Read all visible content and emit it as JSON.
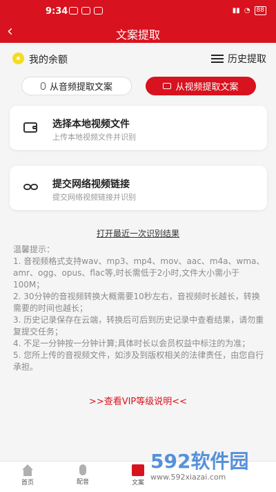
{
  "status_bar": {
    "time": "9:34",
    "battery": "88"
  },
  "header": {
    "title": "文案提取"
  },
  "balance": {
    "label": "我的余额"
  },
  "history": {
    "label": "历史提取"
  },
  "tabs": [
    {
      "label": "从音频提取文案",
      "active": false
    },
    {
      "label": "从视频提取文案",
      "active": true
    }
  ],
  "cards": [
    {
      "title": "选择本地视频文件",
      "subtitle": "上传本地视频文件并识别",
      "icon": "wallet-icon"
    },
    {
      "title": "提交网络视频链接",
      "subtitle": "提交网络视频链接并识别",
      "icon": "link-icon"
    }
  ],
  "open_last": "打开最近一次识别结果",
  "tips": {
    "heading": "温馨提示：",
    "lines": [
      "1. 音视频格式支持wav、mp3、mp4、mov、aac、m4a、wma、amr、ogg、opus、flac等,时长需低于2小时,文件大小需小于100M；",
      "2. 30分钟的音视频转换大概需要10秒左右，音视频时长越长，转换需要的时间也越长；",
      "3. 历史记录保存在云端，转换后可后到历史记录中查看结果，请勿重复提交任务；",
      "4. 不足一分钟按一分钟计算;具体时长以会员权益中标注的为准；",
      "5. 您所上传的音视频文件，如涉及到版权相关的法律责任，由您自行承担。"
    ]
  },
  "vip_link": ">>查看VIP等级说明<<",
  "tabbar": [
    {
      "label": "首页",
      "icon": "home-icon"
    },
    {
      "label": "配音",
      "icon": "mic-icon"
    },
    {
      "label": "文案",
      "icon": "document-icon"
    }
  ],
  "watermark": {
    "brand": "592软件园",
    "url": "www.592xiazai.com"
  },
  "colors": {
    "brand_red": "#d8121e",
    "coin_yellow": "#f6dc1c"
  }
}
